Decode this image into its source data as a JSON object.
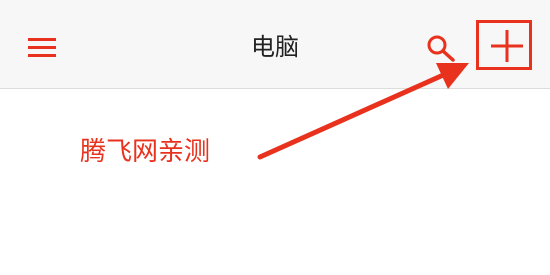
{
  "app_bar": {
    "title": "电脑",
    "menu_icon": "hamburger-menu-icon",
    "search_icon": "search-icon",
    "add_icon": "plus-icon"
  },
  "annotation": {
    "text": "腾飞网亲测"
  },
  "colors": {
    "accent": "#e8321e",
    "app_bar_bg": "#f7f7f7",
    "title_text": "#222222",
    "background": "#ffffff"
  }
}
